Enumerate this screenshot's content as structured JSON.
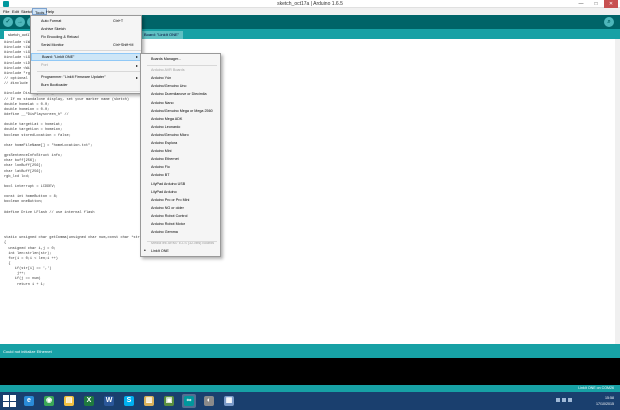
{
  "window": {
    "title": "sketch_oct17a | Arduino 1.6.5",
    "minimize": "—",
    "maximize": "□",
    "close": "✕"
  },
  "menubar": [
    "File",
    "Edit",
    "Sketch",
    "Tools",
    "Help"
  ],
  "toolbar": {
    "buttons": [
      {
        "name": "verify",
        "glyph": "✓"
      },
      {
        "name": "upload",
        "glyph": "→"
      },
      {
        "name": "new",
        "glyph": "▫"
      },
      {
        "name": "open",
        "glyph": "↑"
      },
      {
        "name": "save",
        "glyph": "↓"
      }
    ],
    "serial_glyph": "⌕"
  },
  "tabs": {
    "active": "sketch_oct17a",
    "second": "Board: \"LinkIt ONE\""
  },
  "code": [
    "#include <LWiFi.h>",
    "#include <LWiFiClient.h>",
    "#include <LGPS.h>",
    "#include <LGPRS.h>",
    "#include <LDateTime.h>",
    "#include <Wire.h>",
    "#include \"rgb_lcd.h\"",
    "// optional for sensor",
    "// #include \"DisPlayscreen_h.h\"",
    "",
    "#include DisPlayscreen_h",
    "// If no standalone display, set your marker name (sketch)",
    "double homeLat = 0.0;",
    "double homeLon = 0.0;",
    "#define __\"DisPlayscreen_h\" //",
    "",
    "double targetLat = homeLat;",
    "double targetLon = homeLon;",
    "boolean storedLocation = false;",
    "",
    "char homeFileName[] = \"homeLocation.txt\";",
    "",
    "gpsSentenceInfoStruct info;",
    "char buff[256];",
    "char lonBuff[256];",
    "char latBuff[256];",
    "rgb_lcd lcd;",
    "",
    "bool interrupt = LCDDEV;",
    "",
    "const int homeButton = 8;",
    "boolean oneButton;",
    "",
    "#define Drive LFlash // use internal flash",
    "",
    "",
    "",
    "",
    "static unsigned char getComma(unsigned char num,const char *str)",
    "{",
    "  unsigned char i,j = 0;",
    "  int len=strlen(str);",
    "  for(i = 0;i < len;i ++)",
    "  {",
    "     if(str[i] == ',')",
    "      j++;",
    "     if(j == num)",
    "      return i + 1;"
  ],
  "tools_menu": {
    "items": [
      {
        "label": "Auto Format",
        "shortcut": "Ctrl+T"
      },
      {
        "label": "Archive Sketch",
        "shortcut": ""
      },
      {
        "label": "Fix Encoding & Reload",
        "shortcut": ""
      },
      {
        "label": "Serial Monitor",
        "shortcut": "Ctrl+Shift+M"
      },
      {
        "label": "Board: \"LinkIt ONE\"",
        "shortcut": ""
      },
      {
        "label": "Port",
        "shortcut": ""
      },
      {
        "label": "Programmer: \"LinkIt Firmware Updater\"",
        "shortcut": ""
      },
      {
        "label": "Burn Bootloader",
        "shortcut": ""
      }
    ]
  },
  "board_menu": {
    "items": [
      "Boards Manager...",
      "Arduino AVR Boards",
      "Arduino Yún",
      "Arduino/Genuino Uno",
      "Arduino Duemilanove or Diecimila",
      "Arduino Nano",
      "Arduino/Genuino Mega or Mega 2560",
      "Arduino Mega ADK",
      "Arduino Leonardo",
      "Arduino/Genuino Micro",
      "Arduino Esplora",
      "Arduino Mini",
      "Arduino Ethernet",
      "Arduino Fio",
      "Arduino BT",
      "LilyPad Arduino USB",
      "LilyPad Arduino",
      "Arduino Pro or Pro Mini",
      "Arduino NG or older",
      "Arduino Robot Control",
      "Arduino Robot Motor",
      "Arduino Gemma",
      "MediaTek ARM7 EJ-S (32-bits) Boards",
      "LinkIt ONE"
    ],
    "selected_bullet": "•"
  },
  "console": {
    "message": "Could not initialize Ethernet"
  },
  "status": {
    "right": "LinkIt ONE on COM26"
  },
  "taskbar": {
    "apps": [
      {
        "name": "ie",
        "glyph": "e",
        "color": "#2a8bd8"
      },
      {
        "name": "chrome",
        "glyph": "◉",
        "color": "#3aa757"
      },
      {
        "name": "explorer",
        "glyph": "▤",
        "color": "#f0c040"
      },
      {
        "name": "excel",
        "glyph": "X",
        "color": "#1f7a3f"
      },
      {
        "name": "word",
        "glyph": "W",
        "color": "#2b579a"
      },
      {
        "name": "skype",
        "glyph": "S",
        "color": "#00aff0"
      },
      {
        "name": "files",
        "glyph": "▥",
        "color": "#d9b15a"
      },
      {
        "name": "photos",
        "glyph": "▣",
        "color": "#5a8f3f"
      },
      {
        "name": "arduino",
        "glyph": "∞",
        "color": "#00979d"
      },
      {
        "name": "app10",
        "glyph": "◐",
        "color": "#8a8a8a"
      },
      {
        "name": "app11",
        "glyph": "▦",
        "color": "#7a9ac8"
      }
    ],
    "time": "15:58",
    "date": "17/10/2015"
  },
  "colors": {
    "toolbar": "#006468",
    "tabbar": "#17a1a5",
    "taskbar": "#1a3f6e",
    "highlight": "#cde6f7"
  }
}
